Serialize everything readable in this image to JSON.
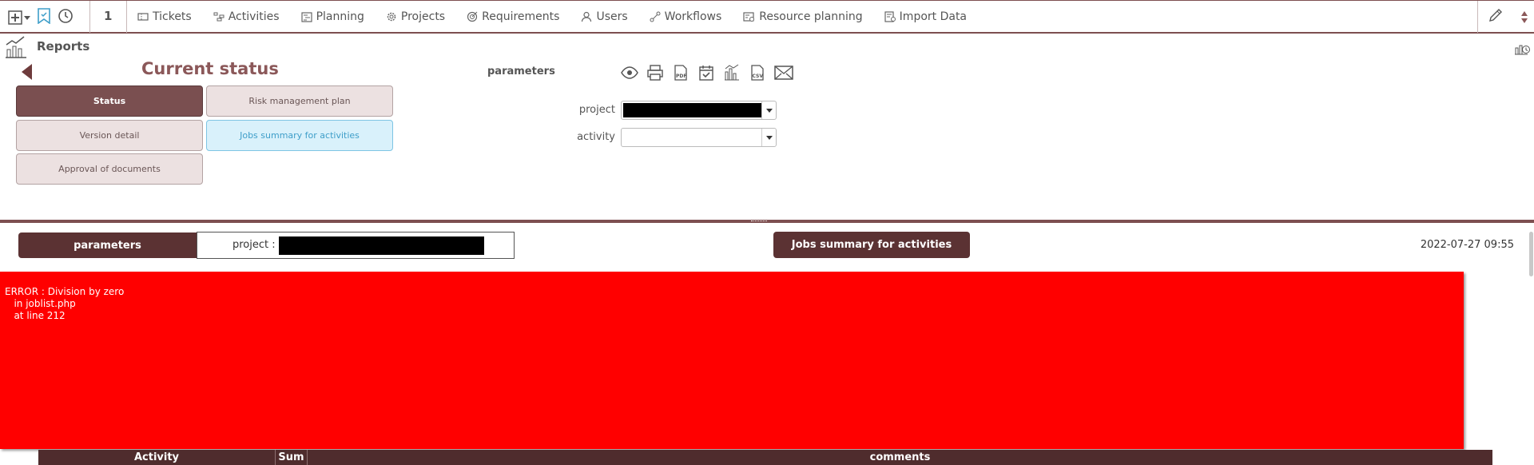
{
  "topbar": {
    "count": "1",
    "menu": [
      {
        "label": "Tickets",
        "icon": "ticket-icon"
      },
      {
        "label": "Activities",
        "icon": "activities-icon"
      },
      {
        "label": "Planning",
        "icon": "planning-icon"
      },
      {
        "label": "Projects",
        "icon": "gear-icon"
      },
      {
        "label": "Requirements",
        "icon": "target-icon"
      },
      {
        "label": "Users",
        "icon": "user-icon"
      },
      {
        "label": "Workflows",
        "icon": "workflow-icon"
      },
      {
        "label": "Resource planning",
        "icon": "resource-planning-icon"
      },
      {
        "label": "Import Data",
        "icon": "import-icon"
      }
    ]
  },
  "reports": {
    "title": "Reports",
    "current_status": "Current status",
    "report_buttons": {
      "status": "Status",
      "risk_management_plan": "Risk management plan",
      "version_detail": "Version detail",
      "jobs_summary": "Jobs summary for activities",
      "approval_of_documents": "Approval of documents"
    },
    "parameters_label": "parameters",
    "fields": {
      "project_label": "project",
      "activity_label": "activity"
    },
    "export_icons": [
      "eye-icon",
      "print-icon",
      "pdf-icon",
      "calendar-check-icon",
      "chart-icon",
      "csv-icon",
      "mail-icon"
    ]
  },
  "result": {
    "parameters_label": "parameters",
    "project_label": "project :",
    "title": "Jobs summary for activities",
    "date": "2022-07-27 09:55",
    "error": {
      "line1": "ERROR : Division by zero",
      "line2": "   in joblist.php",
      "line3": "   at line 212"
    },
    "table_headers": [
      "Activity",
      "Sum",
      "comments"
    ]
  },
  "colors": {
    "brand": "#7d4f50",
    "dark_brand": "#5b3233",
    "error_bg": "#ff0000",
    "selected_bg": "#d9f1fb"
  }
}
